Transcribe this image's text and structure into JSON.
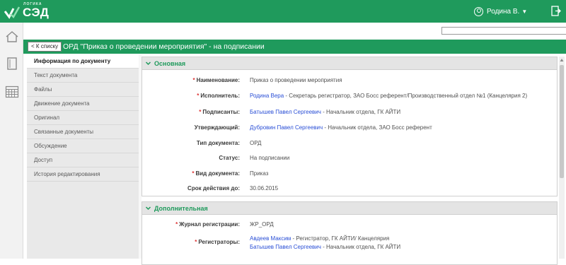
{
  "logo": {
    "sub": "ЛОГИКА",
    "main": "СЭД"
  },
  "user": {
    "name": "Родина В."
  },
  "search": {
    "value": ""
  },
  "document": {
    "back_label": "< К списку",
    "title": "ОРД \"Приказ о проведении мероприятия\" - на подписании"
  },
  "nav": [
    {
      "label": "Информация по документу"
    },
    {
      "label": "Текст документа"
    },
    {
      "label": "Файлы"
    },
    {
      "label": "Движение документа"
    },
    {
      "label": "Оригинал"
    },
    {
      "label": "Связанные документы"
    },
    {
      "label": "Обсуждение"
    },
    {
      "label": "Доступ"
    },
    {
      "label": "История редактирования"
    }
  ],
  "main_section": {
    "title": "Основная",
    "fields": [
      {
        "label": "Наименование:",
        "value": "Приказ о проведении мероприятия",
        "link": ""
      },
      {
        "label": "Исполнитель:",
        "link": "Родина Вера",
        "value": " - Секретарь регистратор, ЗАО Босс референт/Производственный отдел №1 (Канцелярия 2)"
      },
      {
        "label": "Подписанты:",
        "link": "Батышев Павел Сергеевич",
        "value": " - Начальник отдела, ГК АЙТИ"
      },
      {
        "label": "Утверждающий:",
        "link": "Дубровин Павел Сергеевич",
        "value": " - Начальник отдела, ЗАО Босс референт"
      },
      {
        "label": "Тип документа:",
        "value": "ОРД",
        "link": ""
      },
      {
        "label": "Статус:",
        "value": "На подписании",
        "link": ""
      },
      {
        "label": "Вид документа:",
        "value": "Приказ",
        "link": ""
      },
      {
        "label": "Срок действия до:",
        "value": "30.06.2015",
        "link": ""
      }
    ]
  },
  "extra_section": {
    "title": "Дополнительная",
    "fields": [
      {
        "label": "Журнал регистрации:",
        "value": "ЖР_ОРД"
      },
      {
        "label": "Регистраторы:",
        "items": [
          {
            "link": "Авдеев Максим",
            "value": " - Регистратор, ГК АЙТИ/ Канцелярия"
          },
          {
            "link": "Батышев Павел Сергеевич",
            "value": " - Начальник отдела, ГК АЙТИ"
          }
        ]
      }
    ]
  },
  "colors": {
    "brand": "#1f9a5c",
    "link": "#2a4fd6",
    "required": "#dd3333"
  },
  "icons": [
    "logo-check-icon",
    "user-icon",
    "exit-icon",
    "home-icon",
    "document-icon",
    "calendar-grid-icon",
    "search-icon",
    "chevron-down-icon"
  ]
}
